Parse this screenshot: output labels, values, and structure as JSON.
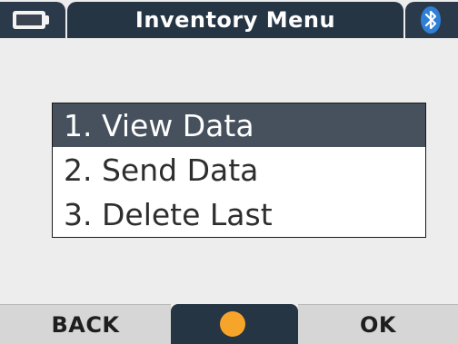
{
  "header": {
    "title": "Inventory Menu",
    "left_icon": "battery-icon",
    "right_icon": "bluetooth-icon"
  },
  "menu": {
    "items": [
      {
        "label": "1. View Data",
        "selected": true
      },
      {
        "label": "2. Send Data",
        "selected": false
      },
      {
        "label": "3. Delete Last",
        "selected": false
      }
    ]
  },
  "softkeys": {
    "left_label": "BACK",
    "center_icon": "orange-dot-icon",
    "right_label": "OK"
  },
  "colors": {
    "header_bg": "#253544",
    "selection_bg": "#46515d",
    "softkey_bg": "#d6d6d6",
    "center_dot": "#f7a42a",
    "background": "#ededed"
  }
}
